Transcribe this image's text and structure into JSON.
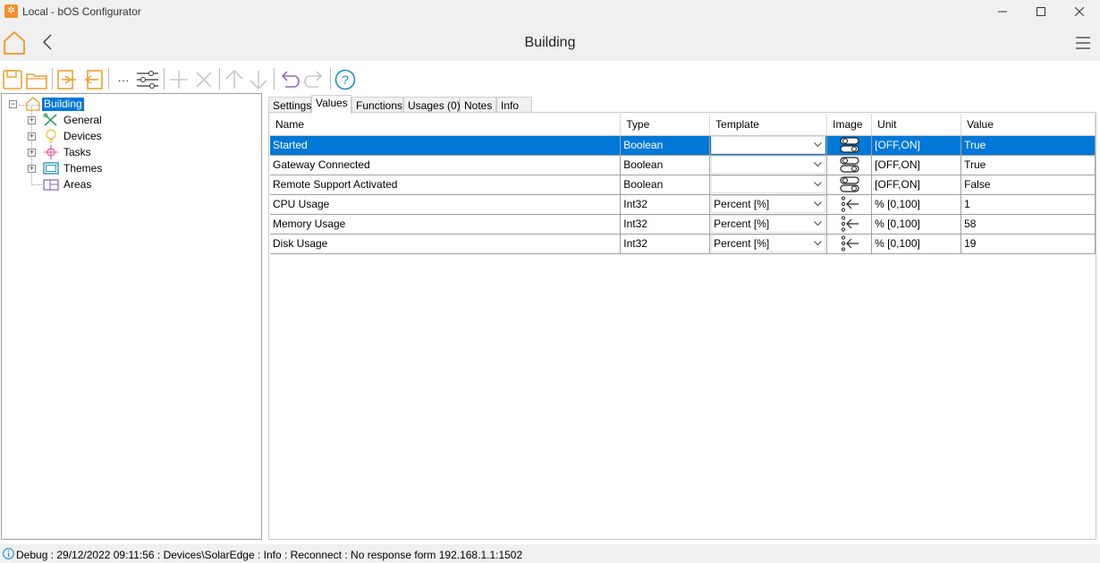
{
  "window": {
    "title": "Local - bOS Configurator",
    "icon": "gear-icon"
  },
  "header": {
    "title": "Building"
  },
  "toolbar": {
    "buttons": [
      "save-icon",
      "open-folder-icon",
      "export-icon",
      "import-icon",
      "more-icon",
      "settings-sliders-icon",
      "add-icon",
      "delete-icon",
      "move-up-icon",
      "move-down-icon",
      "undo-icon",
      "redo-icon",
      "help-icon"
    ],
    "more_label": "···",
    "help_label": "?"
  },
  "tree": {
    "root": {
      "label": "Building"
    },
    "children": [
      {
        "label": "General",
        "icon": "tools-icon"
      },
      {
        "label": "Devices",
        "icon": "bulb-icon"
      },
      {
        "label": "Tasks",
        "icon": "tasks-icon"
      },
      {
        "label": "Themes",
        "icon": "monitor-icon"
      },
      {
        "label": "Areas",
        "icon": "areas-icon"
      }
    ]
  },
  "tabs": [
    {
      "label": "Settings"
    },
    {
      "label": "Values",
      "active": true
    },
    {
      "label": "Functions"
    },
    {
      "label": "Usages (0)"
    },
    {
      "label": "Notes"
    },
    {
      "label": "Info"
    }
  ],
  "table": {
    "columns": [
      "Name",
      "Type",
      "Template",
      "Image",
      "Unit",
      "Value"
    ],
    "rows": [
      {
        "name": "Started",
        "type": "Boolean",
        "template": "",
        "image": "toggle-icon",
        "unit": "[OFF,ON]",
        "value": "True"
      },
      {
        "name": "Gateway Connected",
        "type": "Boolean",
        "template": "",
        "image": "toggle-icon",
        "unit": "[OFF,ON]",
        "value": "True"
      },
      {
        "name": "Remote Support Activated",
        "type": "Boolean",
        "template": "",
        "image": "toggle-icon",
        "unit": "[OFF,ON]",
        "value": "False"
      },
      {
        "name": "CPU Usage",
        "type": "Int32",
        "template": "Percent [%]",
        "image": "numeric-input-icon",
        "unit": "% [0,100]",
        "value": "1"
      },
      {
        "name": "Memory Usage",
        "type": "Int32",
        "template": "Percent [%]",
        "image": "numeric-input-icon",
        "unit": "% [0,100]",
        "value": "58"
      },
      {
        "name": "Disk Usage",
        "type": "Int32",
        "template": "Percent [%]",
        "image": "numeric-input-icon",
        "unit": "% [0,100]",
        "value": "19"
      }
    ]
  },
  "status": {
    "text": "Debug : 29/12/2022 09:11:56 : Devices\\SolarEdge : Info : Reconnect : No response form 192.168.1.1:1502"
  },
  "colors": {
    "accent": "#0078d7",
    "toolbar_orange": "#f0a030",
    "tree_green": "#3aa060",
    "tree_pink": "#e060a0",
    "tree_teal": "#1a90b0"
  }
}
